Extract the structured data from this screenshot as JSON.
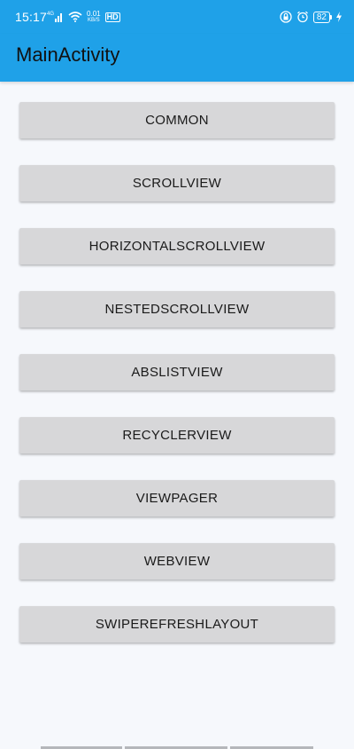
{
  "status_bar": {
    "time": "15:17",
    "signal_label": "4G",
    "speed_value": "0.01",
    "speed_unit": "KB/S",
    "hd_label": "HD",
    "battery": "82"
  },
  "app_bar": {
    "title": "MainActivity"
  },
  "buttons": [
    {
      "label": "COMMON"
    },
    {
      "label": "SCROLLVIEW"
    },
    {
      "label": "HORIZONTALSCROLLVIEW"
    },
    {
      "label": "NESTEDSCROLLVIEW"
    },
    {
      "label": "ABSLISTVIEW"
    },
    {
      "label": "RECYCLERVIEW"
    },
    {
      "label": "VIEWPAGER"
    },
    {
      "label": "WEBVIEW"
    },
    {
      "label": "SWIPEREFRESHLAYOUT"
    }
  ],
  "icons": {
    "signal": "cellular-signal-icon",
    "wifi": "wifi-icon",
    "lock": "lock-icon",
    "alarm": "alarm-icon",
    "charging": "charging-icon"
  },
  "colors": {
    "app_bar": "#1fa1e8",
    "background": "#f6f8fc",
    "button": "#d7d7d9",
    "text": "#1a1a1a"
  }
}
